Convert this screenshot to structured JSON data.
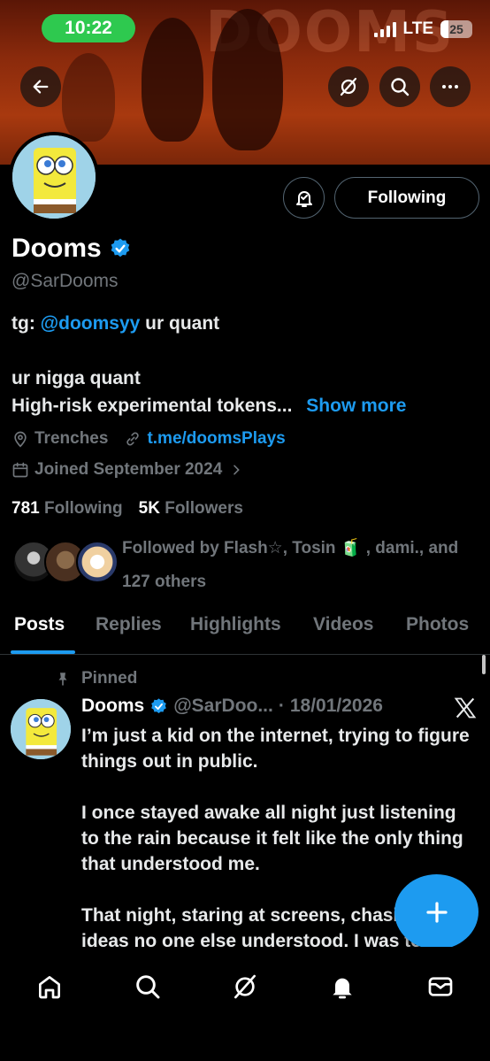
{
  "status_bar": {
    "time": "10:22",
    "network": "LTE",
    "battery": "25",
    "battery_level": 0.25
  },
  "banner": {
    "watermark": "DOOMS"
  },
  "header_actions": {
    "back_icon": "back-arrow-icon",
    "grok_icon": "grok-icon",
    "search_icon": "search-icon",
    "more_icon": "more-icon"
  },
  "profile": {
    "name": "Dooms",
    "handle": "@SarDooms",
    "verified": true,
    "follow_state": "Following",
    "bio_line1_prefix": "tg: ",
    "bio_line1_link": "@doomsyy",
    "bio_line1_suffix": " ur quant",
    "bio_line2": "ur nigga quant",
    "bio_line3": "High-risk experimental tokens...",
    "show_more": "Show more",
    "location": "Trenches",
    "website": "t.me/doomsPlays",
    "joined": "Joined September 2024",
    "following_count": "781",
    "following_label": "Following",
    "followers_count": "5K",
    "followers_label": "Followers",
    "followed_by_line1": "Followed by Flash☆, Tosin 🧃 , dami., and",
    "followed_by_line2": "127 others"
  },
  "tabs": [
    "Posts",
    "Replies",
    "Highlights",
    "Videos",
    "Photos"
  ],
  "post": {
    "pinned_label": "Pinned",
    "author": "Dooms",
    "handle": "@SarDoo...",
    "separator": "·",
    "date": "18/01/2026",
    "paragraph1": "I’m just a kid on the internet, trying to figure things out in public.",
    "paragraph2": "I once stayed awake all night just listening to the rain because it felt like the only thing that understood me.",
    "paragraph3": "That night, staring at screens, chasing ideas no one else understood, I was told"
  },
  "fab": {
    "icon": "plus-icon"
  },
  "bottom_nav": [
    "home-icon",
    "search-icon",
    "grok-icon",
    "notifications-icon",
    "messages-icon"
  ],
  "colors": {
    "accent": "#1d9bf0",
    "status_green": "#2ec94f",
    "banner": "#8a2a0c",
    "muted": "#71767b"
  }
}
